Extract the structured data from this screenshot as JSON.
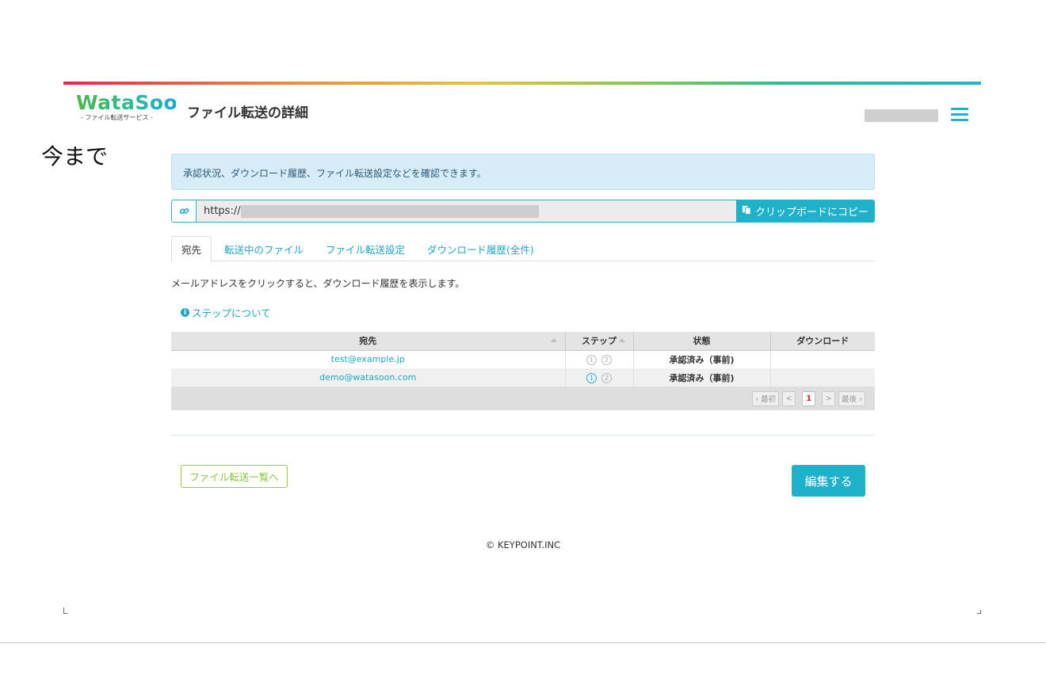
{
  "header": {
    "logo_text": "WataSoon",
    "logo_subtitle": "- ファイル転送サービス -",
    "page_title": "ファイル転送の詳細"
  },
  "annotation": "今まで",
  "info_message": "承認状況、ダウンロード履歴、ファイル転送設定などを確認できます。",
  "url_bar": {
    "value": "https://",
    "copy_label": "クリップボードにコピー"
  },
  "tabs": [
    {
      "label": "宛先",
      "active": true
    },
    {
      "label": "転送中のファイル",
      "active": false
    },
    {
      "label": "ファイル転送設定",
      "active": false
    },
    {
      "label": "ダウンロード履歴(全件)",
      "active": false
    }
  ],
  "hint_text": "メールアドレスをクリックすると、ダウンロード履歴を表示します。",
  "step_link": "ステップについて",
  "table": {
    "columns": [
      "宛先",
      "ステップ",
      "状態",
      "ダウンロード"
    ],
    "rows": [
      {
        "email": "test@example.jp",
        "steps": [
          "1",
          "2"
        ],
        "step_active": false,
        "status": "承認済み（事前)",
        "download": ""
      },
      {
        "email": "demo@watasoon.com",
        "steps": [
          "1",
          "2"
        ],
        "step_active": true,
        "status": "承認済み（事前)",
        "download": ""
      }
    ]
  },
  "pagination": {
    "first": "‹ 最初",
    "prev": "<",
    "current": "1",
    "next": ">",
    "last": "最後 ›"
  },
  "buttons": {
    "back": "ファイル転送一覧へ",
    "edit": "編集する"
  },
  "footer": "© KEYPOINT.INC",
  "colors": {
    "accent": "#1fb1c9",
    "link": "#1fa7c4",
    "green_outline": "#9acd32",
    "info_bg": "#d7ecf7"
  }
}
